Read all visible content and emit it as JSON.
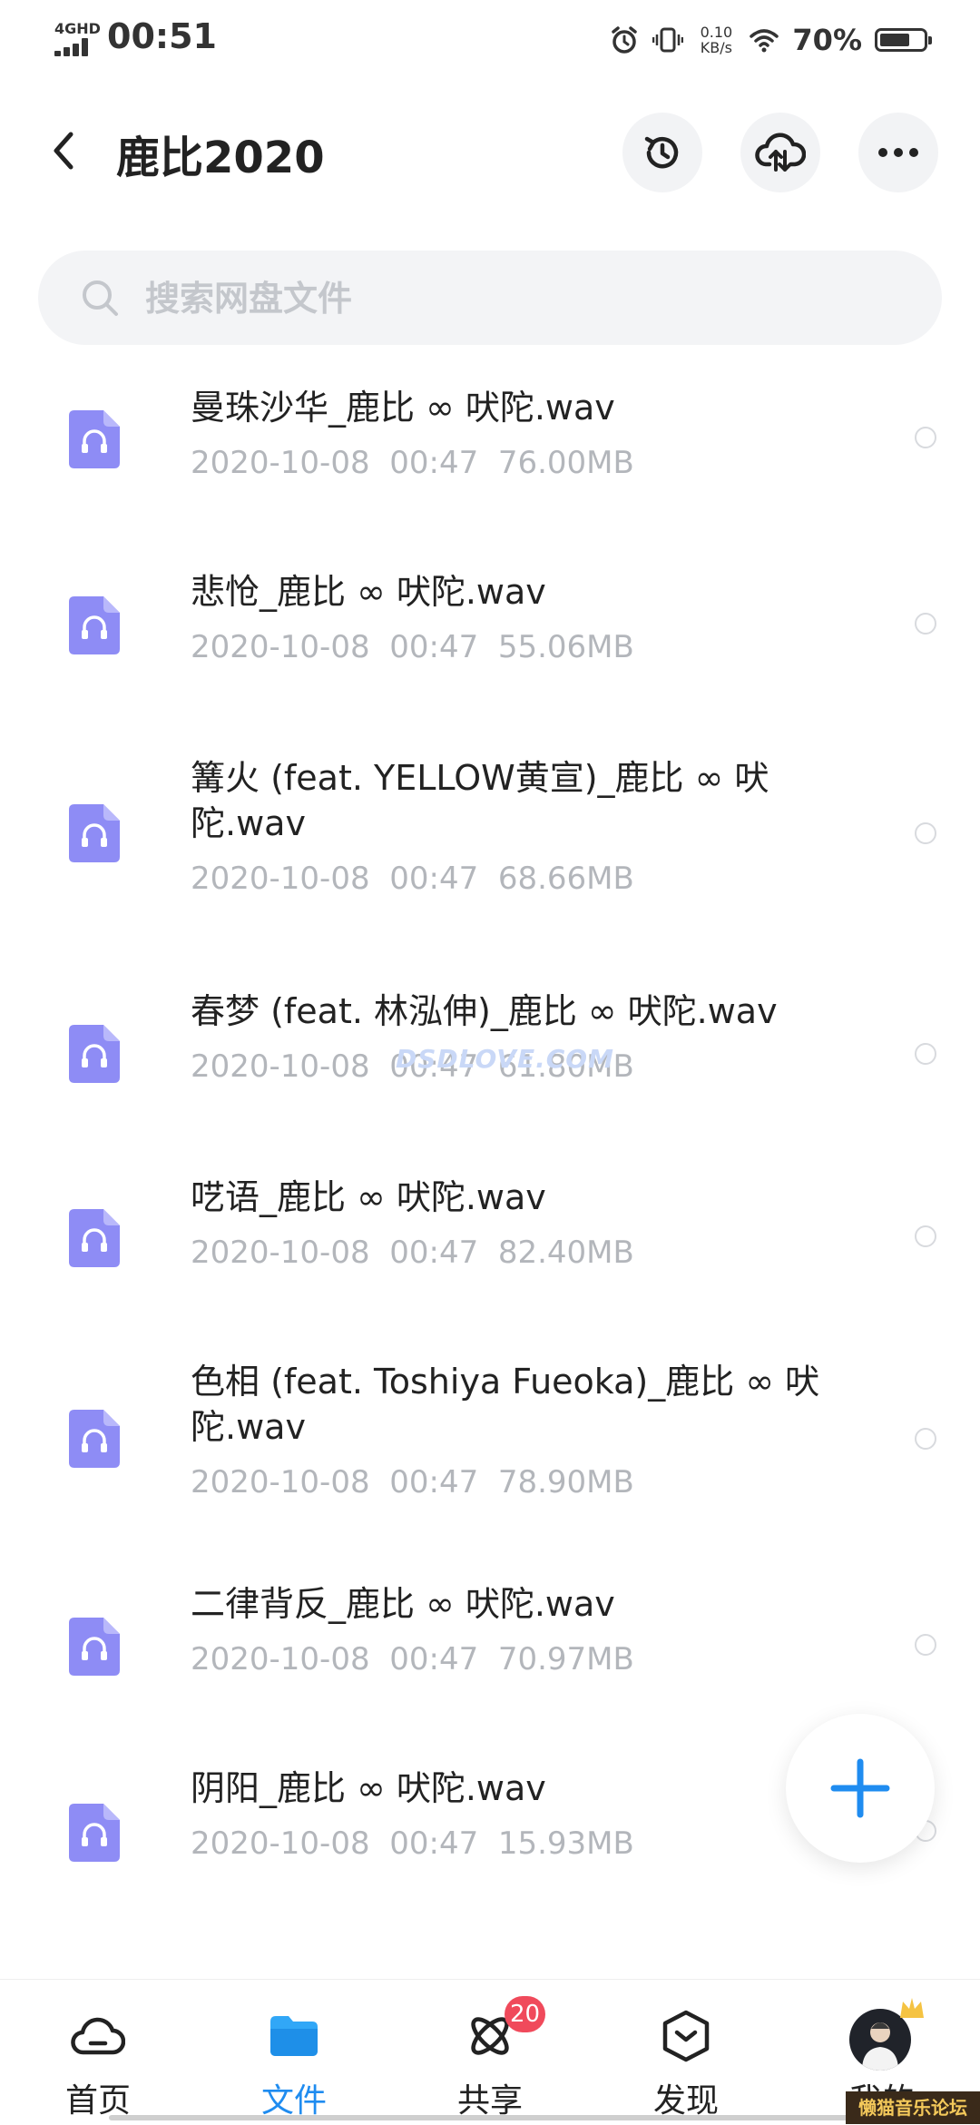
{
  "status_bar": {
    "network": "4GHD",
    "time": "00:51",
    "speed_value": "0.10",
    "speed_unit": "KB/s",
    "battery_percent": "70%",
    "battery_level": 0.7,
    "icons": [
      "signal-icon",
      "alarm-icon",
      "vibrate-icon",
      "wifi-icon",
      "battery-icon"
    ]
  },
  "header": {
    "title": "鹿比2020",
    "back_icon": "back-arrow-icon",
    "actions": [
      "history-icon",
      "cloud-upload-icon",
      "more-icon"
    ]
  },
  "search": {
    "placeholder": "搜索网盘文件"
  },
  "files": [
    {
      "name": "曼珠沙华_鹿比 ∞ 吠陀.wav",
      "date": "2020-10-08",
      "time": "00:47",
      "size": "76.00MB"
    },
    {
      "name": "悲怆_鹿比 ∞ 吠陀.wav",
      "date": "2020-10-08",
      "time": "00:47",
      "size": "55.06MB"
    },
    {
      "name": "篝火 (feat. YELLOW黄宣)_鹿比 ∞ 吠陀.wav",
      "date": "2020-10-08",
      "time": "00:47",
      "size": "68.66MB"
    },
    {
      "name": "春梦 (feat. 林泓伸)_鹿比 ∞ 吠陀.wav",
      "date": "2020-10-08",
      "time": "00:47",
      "size": "61.80MB"
    },
    {
      "name": "呓语_鹿比 ∞ 吠陀.wav",
      "date": "2020-10-08",
      "time": "00:47",
      "size": "82.40MB"
    },
    {
      "name": "色相 (feat. Toshiya Fueoka)_鹿比 ∞ 吠陀.wav",
      "date": "2020-10-08",
      "time": "00:47",
      "size": "78.90MB"
    },
    {
      "name": "二律背反_鹿比 ∞ 吠陀.wav",
      "date": "2020-10-08",
      "time": "00:47",
      "size": "70.97MB"
    },
    {
      "name": "阴阳_鹿比 ∞ 吠陀.wav",
      "date": "2020-10-08",
      "time": "00:47",
      "size": "15.93MB"
    }
  ],
  "watermark": "DSDLOVE.COM",
  "fab_icon": "plus-icon",
  "bottom_nav": [
    {
      "label": "首页",
      "icon": "cloud-home-icon",
      "active": false
    },
    {
      "label": "文件",
      "icon": "folder-icon",
      "active": true
    },
    {
      "label": "共享",
      "icon": "atom-share-icon",
      "active": false,
      "badge": "20"
    },
    {
      "label": "发现",
      "icon": "discover-box-icon",
      "active": false
    },
    {
      "label": "我的",
      "icon": "avatar",
      "active": false
    }
  ],
  "corner_mark": "懒猫音乐论坛",
  "colors": {
    "accent": "#1f8cf0",
    "file_icon": "#8e8cf5",
    "badge": "#f04a5b",
    "meta_text": "#b3b6bb"
  }
}
